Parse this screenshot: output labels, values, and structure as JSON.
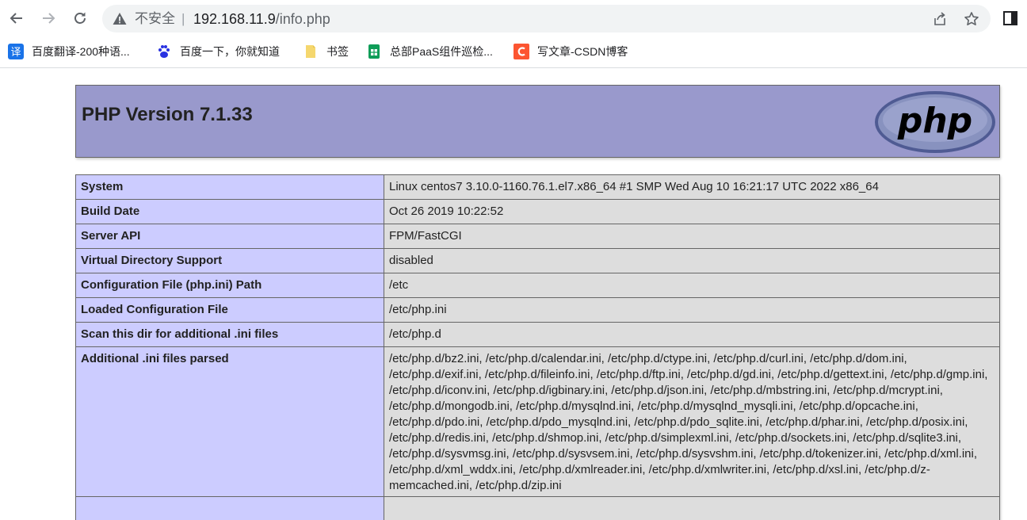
{
  "browser": {
    "security_label": "不安全",
    "separator": "|",
    "url_host": "192.168.11.9",
    "url_path": "/info.php",
    "bookmarks": [
      {
        "label": "百度翻译-200种语...",
        "icon": "translate-icon",
        "color": "#1a73e8"
      },
      {
        "label": "百度一下，你就知道",
        "icon": "baidu-paw-icon",
        "color": "#2932e1"
      },
      {
        "label": "书签",
        "icon": "folder-icon",
        "color": "#f5d76e"
      },
      {
        "label": "总部PaaS组件巡检...",
        "icon": "sheets-icon",
        "color": "#0f9d58"
      },
      {
        "label": "写文章-CSDN博客",
        "icon": "csdn-icon",
        "color": "#fc5531"
      }
    ]
  },
  "php": {
    "title": "PHP Version 7.1.33",
    "logo_text": "php",
    "rows": [
      {
        "key": "System",
        "value": "Linux centos7 3.10.0-1160.76.1.el7.x86_64 #1 SMP Wed Aug 10 16:21:17 UTC 2022 x86_64"
      },
      {
        "key": "Build Date",
        "value": "Oct 26 2019 10:22:52"
      },
      {
        "key": "Server API",
        "value": "FPM/FastCGI"
      },
      {
        "key": "Virtual Directory Support",
        "value": "disabled"
      },
      {
        "key": "Configuration File (php.ini) Path",
        "value": "/etc"
      },
      {
        "key": "Loaded Configuration File",
        "value": "/etc/php.ini"
      },
      {
        "key": "Scan this dir for additional .ini files",
        "value": "/etc/php.d"
      },
      {
        "key": "Additional .ini files parsed",
        "value": "/etc/php.d/bz2.ini, /etc/php.d/calendar.ini, /etc/php.d/ctype.ini, /etc/php.d/curl.ini, /etc/php.d/dom.ini, /etc/php.d/exif.ini, /etc/php.d/fileinfo.ini, /etc/php.d/ftp.ini, /etc/php.d/gd.ini, /etc/php.d/gettext.ini, /etc/php.d/gmp.ini, /etc/php.d/iconv.ini, /etc/php.d/igbinary.ini, /etc/php.d/json.ini, /etc/php.d/mbstring.ini, /etc/php.d/mcrypt.ini, /etc/php.d/mongodb.ini, /etc/php.d/mysqlnd.ini, /etc/php.d/mysqlnd_mysqli.ini, /etc/php.d/opcache.ini, /etc/php.d/pdo.ini, /etc/php.d/pdo_mysqlnd.ini, /etc/php.d/pdo_sqlite.ini, /etc/php.d/phar.ini, /etc/php.d/posix.ini, /etc/php.d/redis.ini, /etc/php.d/shmop.ini, /etc/php.d/simplexml.ini, /etc/php.d/sockets.ini, /etc/php.d/sqlite3.ini, /etc/php.d/sysvmsg.ini, /etc/php.d/sysvsem.ini, /etc/php.d/sysvshm.ini, /etc/php.d/tokenizer.ini, /etc/php.d/xml.ini, /etc/php.d/xml_wddx.ini, /etc/php.d/xmlreader.ini, /etc/php.d/xmlwriter.ini, /etc/php.d/xsl.ini, /etc/php.d/z-memcached.ini, /etc/php.d/zip.ini"
      }
    ]
  }
}
